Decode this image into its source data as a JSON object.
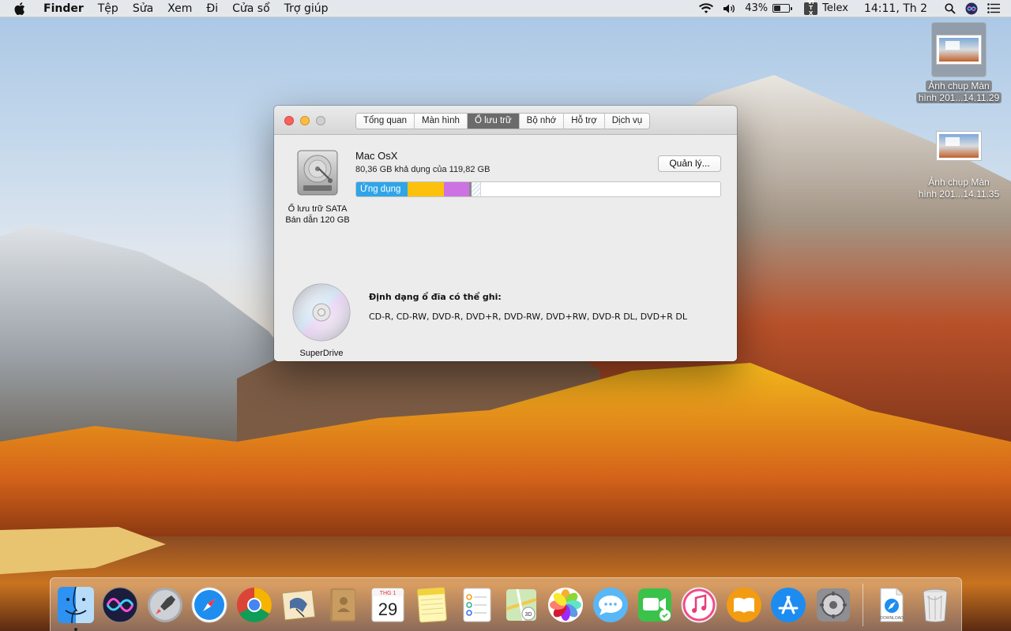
{
  "menubar": {
    "app_name": "Finder",
    "items": [
      "Tệp",
      "Sửa",
      "Xem",
      "Đi",
      "Cửa sổ",
      "Trợ giúp"
    ],
    "battery_percent": "43%",
    "battery_level": 0.43,
    "input_badge": "VI TX",
    "input_method": "Telex",
    "clock": "14:11, Th 2"
  },
  "desktop": {
    "icons": [
      {
        "label_line1": "Ảnh chụp Màn",
        "label_line2": "hình 201...14.11.29",
        "selected": true
      },
      {
        "label_line1": "Ảnh chụp Màn",
        "label_line2": "hình 201...14.11.35",
        "selected": false
      }
    ]
  },
  "window": {
    "tabs": [
      "Tổng quan",
      "Màn hình",
      "Ổ lưu trữ",
      "Bộ nhớ",
      "Hỗ trợ",
      "Dịch vụ"
    ],
    "active_tab": "Ổ lưu trữ",
    "disk": {
      "caption_line1": "Ổ lưu trữ SATA",
      "caption_line2": "Bán dẫn 120 GB",
      "volume_name": "Mac OsX",
      "available": "80,36 GB khả dụng của 119,82 GB",
      "manage_button": "Quản lý...",
      "segments": [
        {
          "label": "Ứng dụng",
          "type": "apps",
          "fraction": 0.14,
          "color": "#2fa5e8"
        },
        {
          "label": "",
          "type": "yellow",
          "fraction": 0.1,
          "color": "#fbc10d"
        },
        {
          "label": "",
          "type": "purple",
          "fraction": 0.07,
          "color": "#cd72e2"
        },
        {
          "label": "",
          "type": "gray",
          "fraction": 0.007,
          "color": "#8a8a8a"
        },
        {
          "label": "",
          "type": "striped",
          "fraction": 0.025,
          "color": "#dfe9f3"
        }
      ]
    },
    "superdrive": {
      "caption": "SuperDrive",
      "burn_title": "Định dạng ổ đĩa có thể ghi:",
      "burn_formats": "CD-R, CD-RW, DVD-R, DVD+R, DVD-RW, DVD+RW, DVD-R DL, DVD+R DL"
    }
  },
  "dock": {
    "apps": [
      {
        "name": "finder-icon",
        "running": true
      },
      {
        "name": "siri-icon",
        "running": false
      },
      {
        "name": "launchpad-icon",
        "running": false
      },
      {
        "name": "safari-icon",
        "running": false
      },
      {
        "name": "chrome-icon",
        "running": false
      },
      {
        "name": "mail-icon",
        "running": false
      },
      {
        "name": "contacts-icon",
        "running": false
      },
      {
        "name": "calendar-icon",
        "running": false,
        "month": "THG 1",
        "day": "29"
      },
      {
        "name": "notes-icon",
        "running": false
      },
      {
        "name": "reminders-icon",
        "running": false
      },
      {
        "name": "maps-icon",
        "running": false,
        "badge": "3D"
      },
      {
        "name": "photos-icon",
        "running": false
      },
      {
        "name": "messages-icon",
        "running": false
      },
      {
        "name": "facetime-icon",
        "running": false
      },
      {
        "name": "itunes-icon",
        "running": false
      },
      {
        "name": "ibooks-icon",
        "running": false
      },
      {
        "name": "app-store-icon",
        "running": false
      },
      {
        "name": "system-preferences-icon",
        "running": false
      }
    ],
    "downloads_label": "DOWNLOAD"
  }
}
